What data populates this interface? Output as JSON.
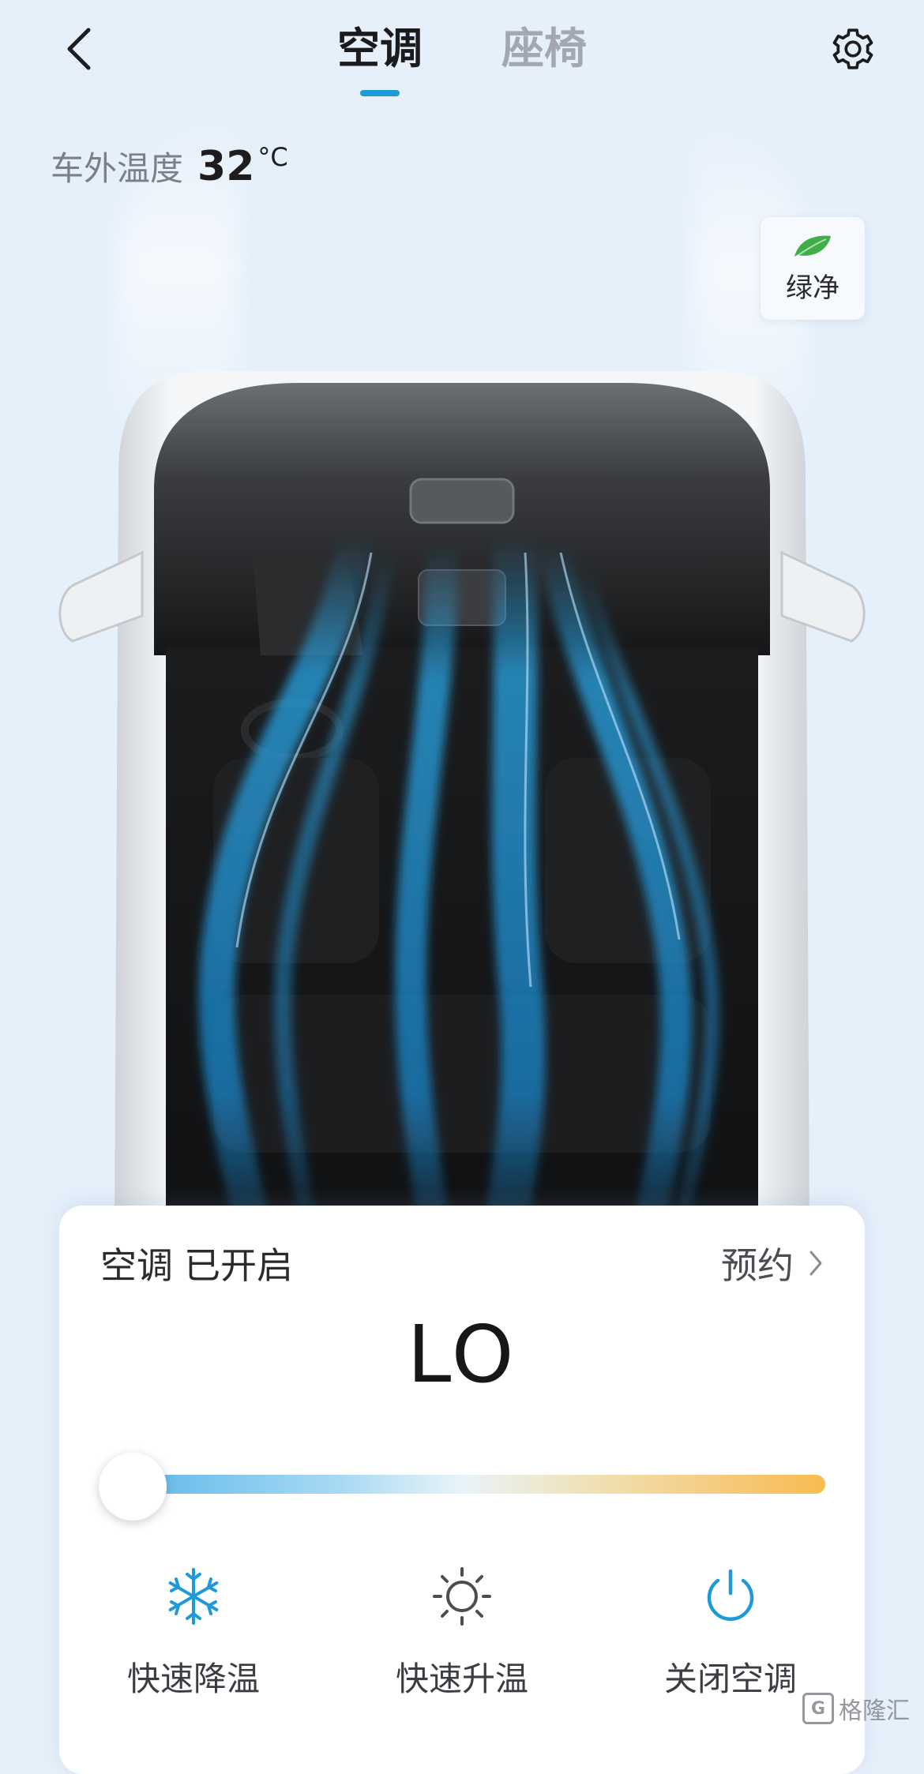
{
  "header": {
    "tabs": [
      {
        "label": "空调",
        "active": true
      },
      {
        "label": "座椅",
        "active": false
      }
    ]
  },
  "outside_temp": {
    "label": "车外温度",
    "value": "32",
    "unit": "°C"
  },
  "green_purify": {
    "label": "绿净",
    "icon": "leaf-icon"
  },
  "ac_panel": {
    "title": "空调",
    "status": "已开启",
    "schedule_label": "预约",
    "temperature": "LO",
    "slider_level": 0.0,
    "quick_actions": [
      {
        "label": "快速降温",
        "icon": "snowflake-icon",
        "color": "#1e9bd7"
      },
      {
        "label": "快速升温",
        "icon": "sun-icon",
        "color": "#4a4d52"
      },
      {
        "label": "关闭空调",
        "icon": "power-icon",
        "color": "#1e9bd7"
      }
    ]
  },
  "watermark": {
    "text": "格隆汇"
  },
  "colors": {
    "accent": "#1e9bd7",
    "background": "#e6f0fb",
    "leaf": "#3fae49"
  }
}
